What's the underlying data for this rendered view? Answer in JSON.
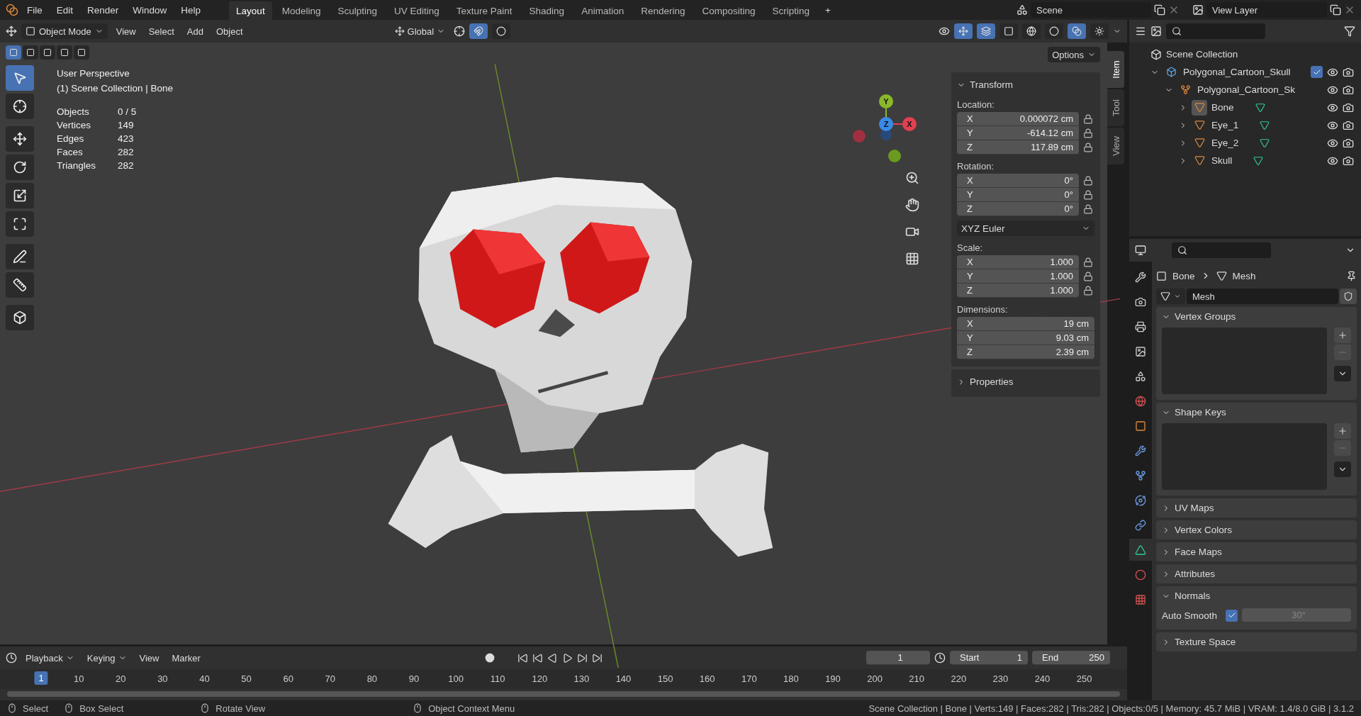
{
  "menu": [
    "File",
    "Edit",
    "Render",
    "Window",
    "Help"
  ],
  "workspaces": [
    {
      "label": "Layout",
      "selected": true
    },
    {
      "label": "Modeling",
      "selected": false
    },
    {
      "label": "Sculpting",
      "selected": false
    },
    {
      "label": "UV Editing",
      "selected": false
    },
    {
      "label": "Texture Paint",
      "selected": false
    },
    {
      "label": "Shading",
      "selected": false
    },
    {
      "label": "Animation",
      "selected": false
    },
    {
      "label": "Rendering",
      "selected": false
    },
    {
      "label": "Compositing",
      "selected": false
    },
    {
      "label": "Scripting",
      "selected": false
    }
  ],
  "add_workspace": "+",
  "scene": "Scene",
  "view_layer": "View Layer",
  "viewport": {
    "mode": "Object Mode",
    "menus": [
      "View",
      "Select",
      "Add",
      "Object"
    ],
    "orientation": "Global",
    "options": "Options",
    "toggles": [
      {
        "kind": "snap",
        "on": true
      },
      {
        "kind": "proportional",
        "on": false
      },
      {
        "kind": "gizmo",
        "on": true
      },
      {
        "kind": "overlay",
        "on": true
      },
      {
        "kind": "xray",
        "on": false
      }
    ],
    "shading": [
      {
        "kind": "wireframe",
        "selected": false
      },
      {
        "kind": "solid",
        "selected": false
      },
      {
        "kind": "material",
        "selected": true
      },
      {
        "kind": "rendered",
        "selected": false
      }
    ],
    "select_modes": [
      {
        "selected": true
      },
      {
        "selected": false
      },
      {
        "selected": false
      },
      {
        "selected": false
      },
      {
        "selected": false
      }
    ],
    "title": "User Perspective",
    "context": "(1) Scene Collection | Bone",
    "stats": [
      {
        "label": "Objects",
        "value": "0 / 5"
      },
      {
        "label": "Vertices",
        "value": "149"
      },
      {
        "label": "Edges",
        "value": "423"
      },
      {
        "label": "Faces",
        "value": "282"
      },
      {
        "label": "Triangles",
        "value": "282"
      }
    ],
    "tools": [
      {
        "kind": "select",
        "selected": true
      },
      {
        "kind": "cursor",
        "selected": false
      },
      {
        "kind": "move",
        "selected": false
      },
      {
        "kind": "rotate",
        "selected": false
      },
      {
        "kind": "scale",
        "selected": false
      },
      {
        "kind": "transform",
        "selected": false
      },
      {
        "kind": "annotate",
        "selected": false
      },
      {
        "kind": "measure",
        "selected": false
      },
      {
        "kind": "add-cube",
        "selected": false
      }
    ],
    "gizmo": {
      "x": "X",
      "y": "Y",
      "z": "Z"
    }
  },
  "sidebar": {
    "tabs": [
      {
        "label": "Item",
        "selected": true
      },
      {
        "label": "Tool",
        "selected": false
      },
      {
        "label": "View",
        "selected": false
      }
    ],
    "transform": {
      "title": "Transform",
      "expanded": true,
      "groups": [
        {
          "label": "Location:",
          "locks": true,
          "fields": [
            {
              "axis": "X",
              "value": "0.000072 cm"
            },
            {
              "axis": "Y",
              "value": "-614.12 cm"
            },
            {
              "axis": "Z",
              "value": "117.89 cm"
            }
          ]
        },
        {
          "label": "Rotation:",
          "locks": true,
          "fields": [
            {
              "axis": "X",
              "value": "0°"
            },
            {
              "axis": "Y",
              "value": "0°"
            },
            {
              "axis": "Z",
              "value": "0°"
            }
          ],
          "mode": "XYZ Euler"
        },
        {
          "label": "Scale:",
          "locks": true,
          "fields": [
            {
              "axis": "X",
              "value": "1.000"
            },
            {
              "axis": "Y",
              "value": "1.000"
            },
            {
              "axis": "Z",
              "value": "1.000"
            }
          ]
        },
        {
          "label": "Dimensions:",
          "locks": false,
          "fields": [
            {
              "axis": "X",
              "value": "19 cm"
            },
            {
              "axis": "Y",
              "value": "9.03 cm"
            },
            {
              "axis": "Z",
              "value": "2.39 cm"
            }
          ]
        }
      ]
    },
    "properties": {
      "title": "Properties",
      "expanded": false
    }
  },
  "outliner": {
    "root": "Scene Collection",
    "items": [
      {
        "label": "Polygonal_Cartoon_Skull",
        "kind": "collection",
        "expanded": true,
        "checked": true,
        "selected": false,
        "children": [
          {
            "label": "Polygonal_Cartoon_Sk",
            "kind": "empty",
            "expanded": true,
            "selected": false,
            "children": [
              {
                "label": "Bone",
                "kind": "mesh",
                "expanded": false,
                "selected": true
              },
              {
                "label": "Eye_1",
                "kind": "mesh",
                "expanded": false,
                "selected": false
              },
              {
                "label": "Eye_2",
                "kind": "mesh",
                "expanded": false,
                "selected": false
              },
              {
                "label": "Skull",
                "kind": "mesh",
                "expanded": false,
                "selected": false
              }
            ]
          }
        ]
      }
    ]
  },
  "properties": {
    "breadcrumb": [
      "Bone",
      "Mesh"
    ],
    "data_name": "Mesh",
    "tabs": [
      {
        "kind": "tool",
        "selected": false
      },
      {
        "kind": "render",
        "selected": false
      },
      {
        "kind": "output",
        "selected": false
      },
      {
        "kind": "view-layer",
        "selected": false
      },
      {
        "kind": "scene",
        "selected": false
      },
      {
        "kind": "world",
        "selected": false
      },
      {
        "kind": "object",
        "selected": false
      },
      {
        "kind": "modifier",
        "selected": false
      },
      {
        "kind": "particles",
        "selected": false
      },
      {
        "kind": "physics",
        "selected": false
      },
      {
        "kind": "constraints",
        "selected": false
      },
      {
        "kind": "data",
        "selected": true
      },
      {
        "kind": "material",
        "selected": false
      },
      {
        "kind": "texture",
        "selected": false
      }
    ],
    "panels": [
      {
        "title": "Vertex Groups",
        "kind": "list",
        "expanded": true
      },
      {
        "title": "Shape Keys",
        "kind": "list",
        "expanded": true
      },
      {
        "title": "UV Maps",
        "kind": "plain",
        "expanded": false
      },
      {
        "title": "Vertex Colors",
        "kind": "plain",
        "expanded": false
      },
      {
        "title": "Face Maps",
        "kind": "plain",
        "expanded": false
      },
      {
        "title": "Attributes",
        "kind": "plain",
        "expanded": false
      },
      {
        "title": "Normals",
        "kind": "normals",
        "expanded": true,
        "option": "Auto Smooth",
        "checked": true,
        "angle": "30°"
      },
      {
        "title": "Texture Space",
        "kind": "plain",
        "expanded": false
      }
    ]
  },
  "timeline": {
    "menus": [
      "Playback",
      "Keying"
    ],
    "plain_menus": [
      "View",
      "Marker"
    ],
    "current_frame": "1",
    "start_label": "Start",
    "start": "1",
    "end_label": "End",
    "end": "250",
    "playhead": "1",
    "ticks": [
      "10",
      "20",
      "30",
      "40",
      "50",
      "60",
      "70",
      "80",
      "90",
      "100",
      "110",
      "120",
      "130",
      "140",
      "150",
      "160",
      "170",
      "180",
      "190",
      "200",
      "210",
      "220",
      "230",
      "240",
      "250"
    ]
  },
  "status_bar": {
    "hints": [
      "Select",
      "Box Select",
      "Rotate View",
      "Object Context Menu"
    ],
    "info": "Scene Collection | Bone | Verts:149 | Faces:282 | Tris:282 | Objects:0/5 | Memory: 45.7 MiB | VRAM: 1.4/8.0 GiB | 3.1.2"
  }
}
